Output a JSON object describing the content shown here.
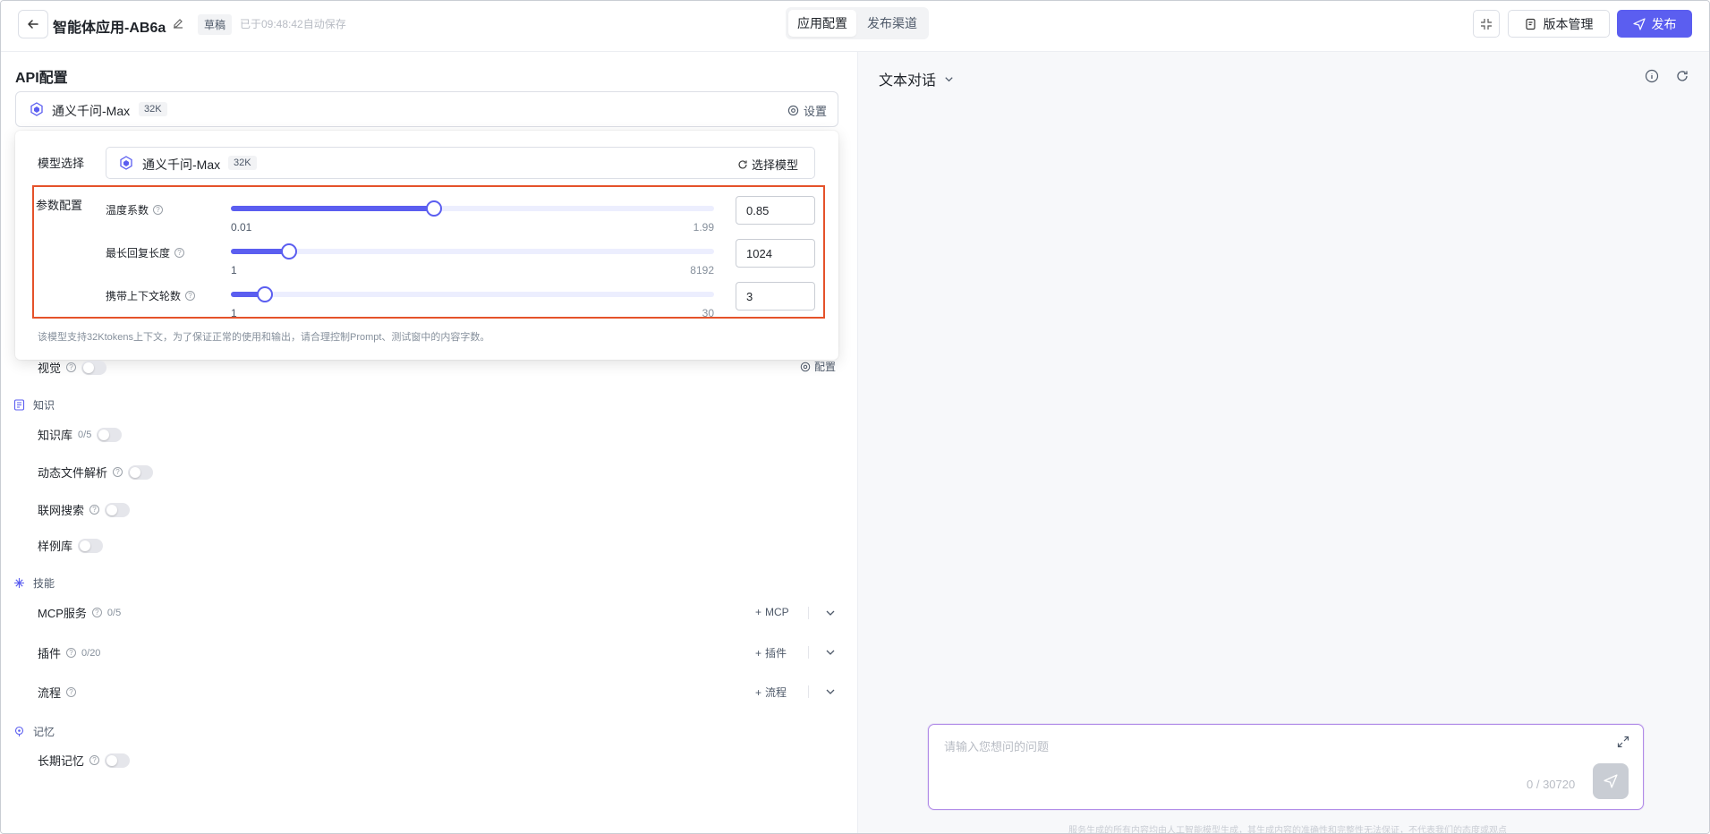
{
  "header": {
    "back_icon": "arrow-left-icon",
    "app_title": "智能体应用-AB6a",
    "draft_badge": "草稿",
    "autosave": "已于09:48:42自动保存",
    "tabs": [
      {
        "label": "应用配置",
        "active": true
      },
      {
        "label": "发布渠道",
        "active": false
      }
    ],
    "version_label": "版本管理",
    "publish_label": "发布",
    "accent_color": "#5b5ef0"
  },
  "left": {
    "api_heading": "API配置",
    "model": {
      "name": "通义千问-Max",
      "tag": "32K"
    },
    "settings_label": "设置",
    "popover": {
      "model_label": "模型选择",
      "model_name": "通义千问-Max",
      "model_tag": "32K",
      "select_model_label": "选择模型",
      "params_label": "参数配置",
      "params": [
        {
          "label": "温度系数",
          "min": "0.01",
          "max": "1.99",
          "value": "0.85",
          "fraction": 0.42
        },
        {
          "label": "最长回复长度",
          "min": "1",
          "max": "8192",
          "value": "1024",
          "fraction": 0.12
        },
        {
          "label": "携带上下文轮数",
          "min": "1",
          "max": "30",
          "value": "3",
          "fraction": 0.07
        }
      ],
      "note": "该模型支持32Ktokens上下文，为了保证正常的使用和输出，请合理控制Prompt、测试窗中的内容字数。"
    },
    "vision": {
      "label": "视觉",
      "config_label": "配置"
    },
    "knowledge": {
      "title": "知识",
      "kb_label": "知识库",
      "kb_count": "0/5",
      "doc_label": "动态文件解析",
      "web_label": "联网搜索",
      "example_label": "样例库"
    },
    "skills": {
      "title": "技能",
      "mcp_label": "MCP服务",
      "mcp_count": "0/5",
      "mcp_add": "MCP",
      "plugin_label": "插件",
      "plugin_count": "0/20",
      "plugin_add": "插件",
      "flow_label": "流程",
      "flow_add": "流程"
    },
    "memory": {
      "title": "记忆",
      "long_label": "长期记忆"
    }
  },
  "right": {
    "chat_mode": "文本对话",
    "input_placeholder": "请输入您想问的问题",
    "char_count": "0 / 30720",
    "disclaimer": "服务生成的所有内容均由人工智能模型生成，其生成内容的准确性和完整性无法保证，不代表我们的态度或观点"
  }
}
